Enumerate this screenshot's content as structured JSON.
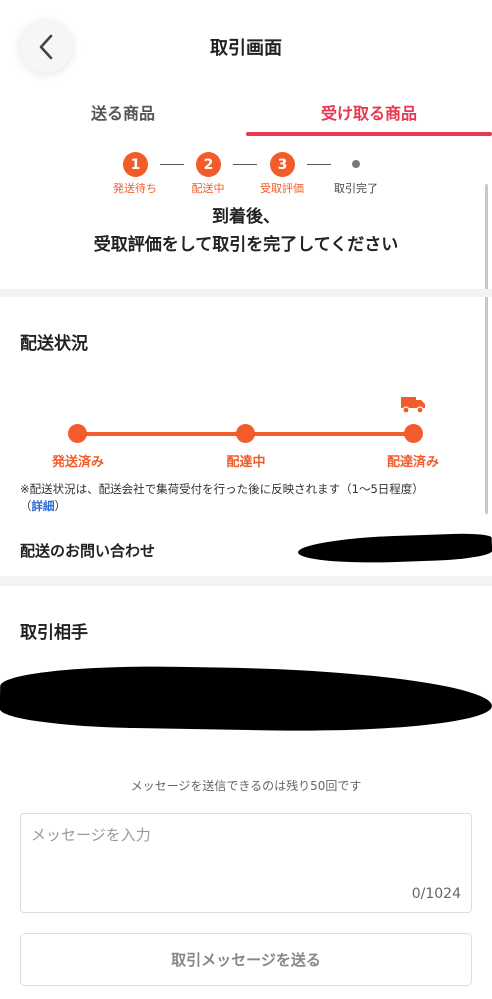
{
  "header": {
    "title": "取引画面",
    "back_icon": "chevron-left-icon"
  },
  "tabs": [
    {
      "label": "送る商品",
      "active": false
    },
    {
      "label": "受け取る商品",
      "active": true
    }
  ],
  "steps": [
    {
      "number": "1",
      "label": "発送待ち",
      "done": true
    },
    {
      "number": "2",
      "label": "配送中",
      "done": true
    },
    {
      "number": "3",
      "label": "受取評価",
      "done": true
    },
    {
      "number": "",
      "label": "取引完了",
      "done": false
    }
  ],
  "notice": {
    "line1": "到着後、",
    "line2": "受取評価をして取引を完了してください"
  },
  "shipping": {
    "title": "配送状況",
    "icon": "truck-icon",
    "stages": [
      "発送済み",
      "配達中",
      "配達済み"
    ],
    "current_stage": 3,
    "note": "※配送状況は、配送会社で集荷受付を行った後に反映されます（1～5日程度）",
    "note_link_open": "（",
    "note_link": "詳細",
    "note_link_close": "）",
    "inquiry_label": "配送のお問い合わせ"
  },
  "partner": {
    "title": "取引相手"
  },
  "message": {
    "remaining": "メッセージを送信できるのは残り50回です",
    "placeholder": "メッセージを入力",
    "counter": "0/1024",
    "send_label": "取引メッセージを送る"
  },
  "colors": {
    "accent": "#f25c2b",
    "tab_active": "#e8384f",
    "link": "#2a6ad8"
  }
}
